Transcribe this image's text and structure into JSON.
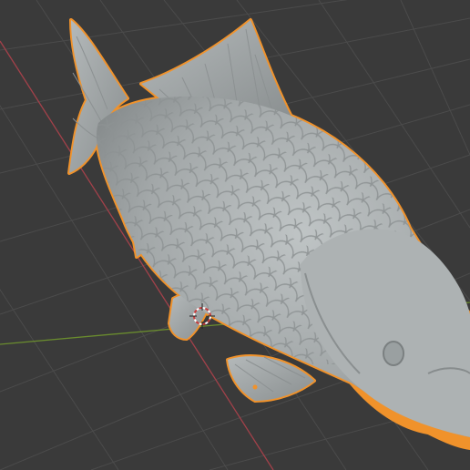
{
  "app": "Blender",
  "view": "3d-viewport",
  "scene": {
    "object": "carp-fish-sculpt",
    "selected": true,
    "mode": "object"
  },
  "colors": {
    "background": "#3a3a3a",
    "grid": "#4a4a4a",
    "x_axis": "#a3414a",
    "y_axis": "#6a8c2e",
    "selection_outline": "#f0922b",
    "mesh": "#a8adae"
  },
  "icons": [
    "3d-cursor-icon",
    "origin-point-icon"
  ]
}
